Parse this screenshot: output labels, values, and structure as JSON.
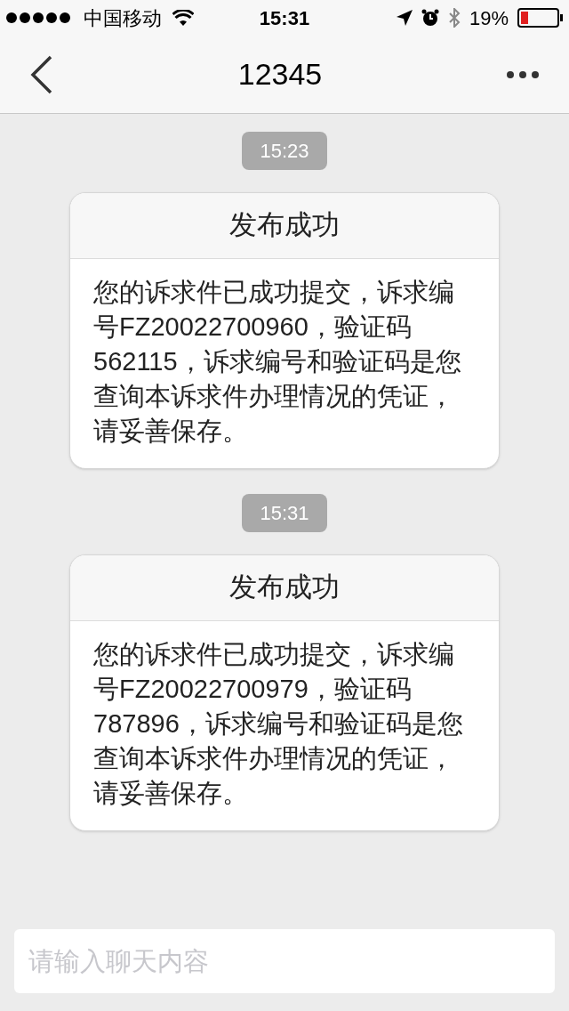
{
  "status_bar": {
    "carrier": "中国移动",
    "time": "15:31",
    "battery_text": "19%"
  },
  "nav": {
    "title": "12345"
  },
  "messages": [
    {
      "time": "15:23",
      "title": "发布成功",
      "body": "您的诉求件已成功提交，诉求编号FZ20022700960，验证码562115，诉求编号和验证码是您查询本诉求件办理情况的凭证，请妥善保存。"
    },
    {
      "time": "15:31",
      "title": "发布成功",
      "body": "您的诉求件已成功提交，诉求编号FZ20022700979，验证码787896，诉求编号和验证码是您查询本诉求件办理情况的凭证，请妥善保存。"
    }
  ],
  "input": {
    "placeholder": "请输入聊天内容"
  }
}
